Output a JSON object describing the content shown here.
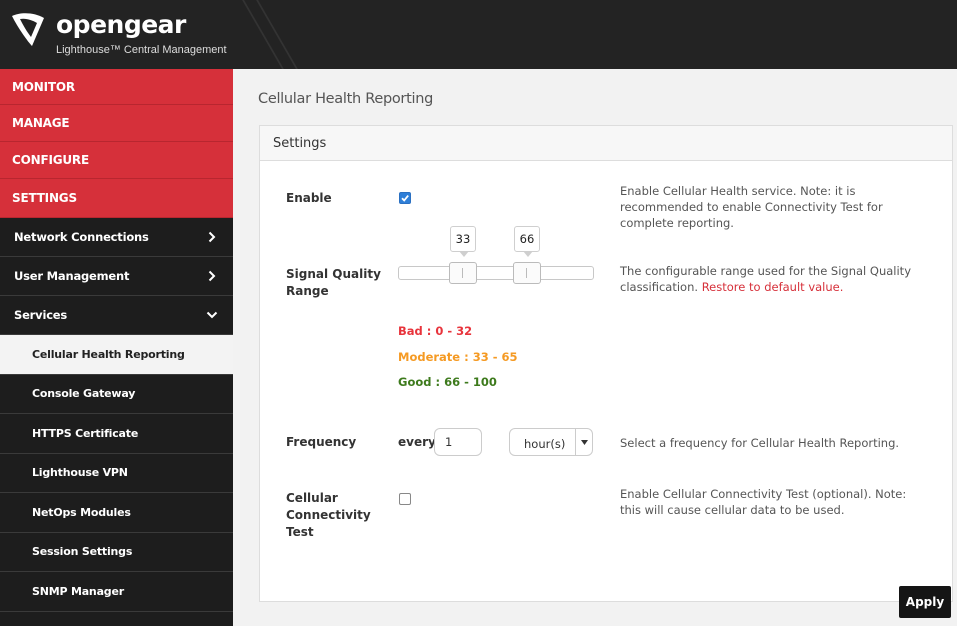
{
  "header": {
    "brand": "opengear",
    "subtitle": "Lighthouse™ Central Management"
  },
  "sidebar": {
    "top_items": [
      {
        "label": "MONITOR"
      },
      {
        "label": "MANAGE"
      },
      {
        "label": "CONFIGURE"
      },
      {
        "label": "SETTINGS"
      }
    ],
    "sections": [
      {
        "label": "Network Connections",
        "icon": "chevron-right-icon"
      },
      {
        "label": "User Management",
        "icon": "chevron-right-icon"
      },
      {
        "label": "Services",
        "icon": "chevron-down-icon"
      }
    ],
    "services_items": [
      {
        "label": "Cellular Health Reporting",
        "active": true
      },
      {
        "label": "Console Gateway"
      },
      {
        "label": "HTTPS Certificate"
      },
      {
        "label": "Lighthouse VPN"
      },
      {
        "label": "NetOps Modules"
      },
      {
        "label": "Session Settings"
      },
      {
        "label": "SNMP Manager"
      }
    ]
  },
  "main": {
    "page_title": "Cellular Health Reporting",
    "panel_title": "Settings",
    "enable": {
      "label": "Enable",
      "checked": true,
      "help": "Enable Cellular Health service. Note: it is recommended to enable Connectivity Test for complete reporting."
    },
    "signal": {
      "label_line1": "Signal Quality",
      "label_line2": "Range",
      "low_value": "33",
      "high_value": "66",
      "low_fraction": 0.33,
      "high_fraction": 0.66,
      "help": "The configurable range used for the Signal Quality classification.",
      "restore_link": "Restore to default value.",
      "legend": {
        "bad": "Bad : 0 - 32",
        "moderate": "Moderate : 33 - 65",
        "good": "Good : 66 - 100"
      },
      "colors": {
        "bad": "#e8343c",
        "moderate": "#f59a23",
        "good": "#3d7a1c"
      }
    },
    "frequency": {
      "label": "Frequency",
      "prefix": "every",
      "value": "1",
      "unit": "hour(s)",
      "help": "Select a frequency for Cellular Health Reporting."
    },
    "connectivity": {
      "label_line1": "Cellular",
      "label_line2": "Connectivity",
      "label_line3": "Test",
      "checked": false,
      "help": "Enable Cellular Connectivity Test (optional). Note: this will cause cellular data to be used."
    },
    "apply_label": "Apply"
  },
  "colors": {
    "accent_red": "#d6303a",
    "sidebar_bg": "#1d1d1d",
    "checkbox_blue": "#2f7fd8"
  }
}
